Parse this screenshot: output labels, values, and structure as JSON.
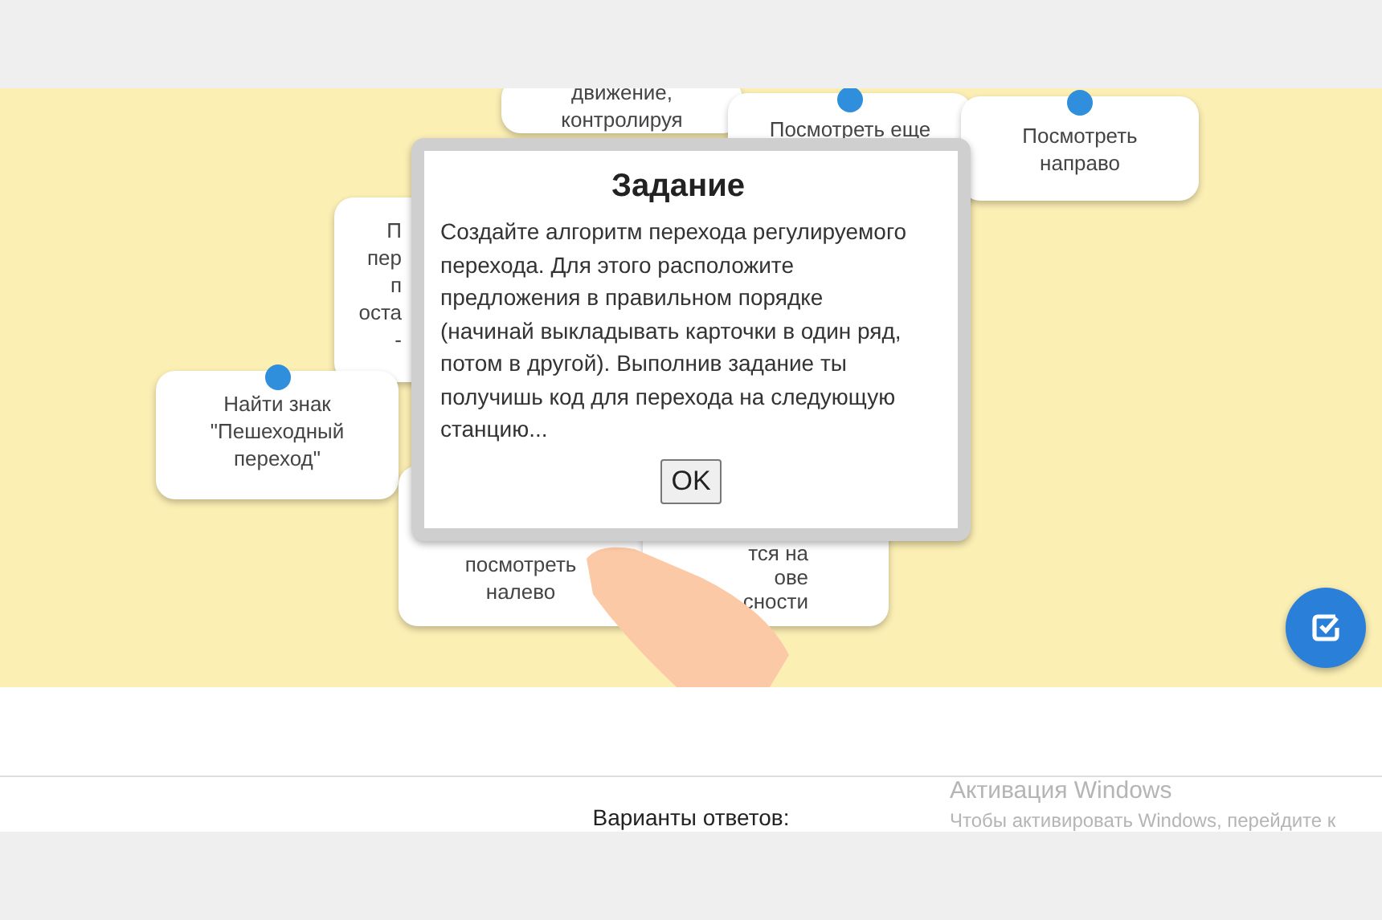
{
  "cards": [
    {
      "kind": "full",
      "pinned": false,
      "lines": [
        "движение,",
        "контролируя"
      ]
    },
    {
      "kind": "full",
      "pinned": true,
      "lines": [
        "Посмотреть еще"
      ]
    },
    {
      "kind": "full",
      "pinned": true,
      "lines": [
        "Посмотреть",
        "направо"
      ]
    },
    {
      "kind": "cut",
      "pinned": false,
      "lines": [
        "П",
        "пер",
        "п",
        "оста",
        "-"
      ]
    },
    {
      "kind": "full",
      "pinned": true,
      "lines": [
        "Найти знак",
        "\"Пешеходный",
        "переход\""
      ]
    },
    {
      "kind": "full",
      "pinned": false,
      "lines": [
        "посмотреть",
        "налево"
      ]
    },
    {
      "kind": "full",
      "pinned": false,
      "lines": [
        "тся на",
        "ове",
        "сности"
      ]
    }
  ],
  "dialog": {
    "title": "Задание",
    "text": "Создайте алгоритм перехода регулируемого перехода. Для этого расположите предложения в правильном порядке (начинай выкладывать карточки в один ряд, потом в другой). Выполнив задание ты получишь код для перехода на следующую станцию...",
    "button": "OK"
  },
  "answers_label": "Варианты ответов:",
  "activation": {
    "title": "Активация Windows",
    "text": "Чтобы активировать Windows, перейдите к"
  }
}
